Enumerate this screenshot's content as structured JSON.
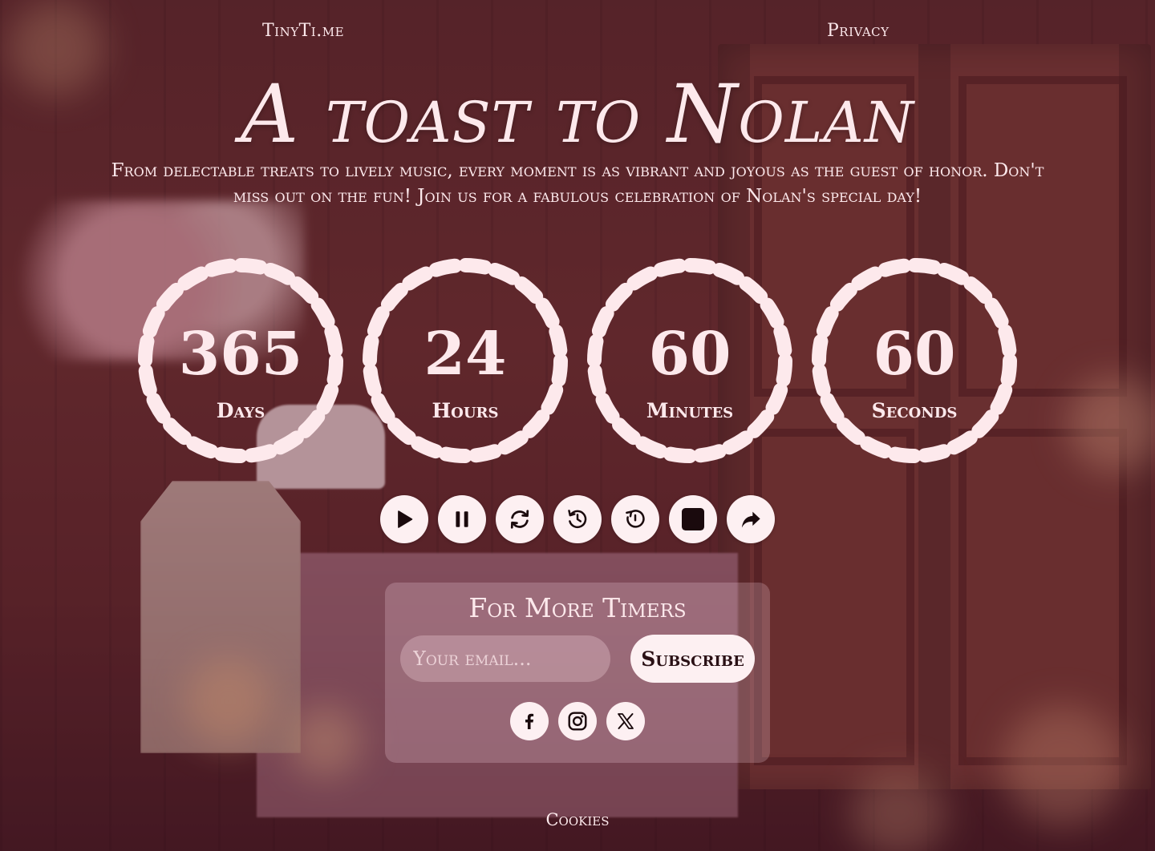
{
  "nav": {
    "brand": "TinyTi.me",
    "privacy": "Privacy"
  },
  "hero": {
    "title": "A toast to Nolan",
    "tagline": "From delectable treats to lively music, every moment is as vibrant and joyous as the guest of honor. Don't miss out on the fun! Join us for a fabulous celebration of Nolan's special day!"
  },
  "countdown": [
    {
      "value": "365",
      "unit": "Days"
    },
    {
      "value": "24",
      "unit": "Hours"
    },
    {
      "value": "60",
      "unit": "Minutes"
    },
    {
      "value": "60",
      "unit": "Seconds"
    }
  ],
  "controls": [
    "play-icon",
    "pause-icon",
    "refresh-icon",
    "history-icon",
    "reset-timer-icon",
    "stop-icon",
    "share-icon"
  ],
  "subscribe": {
    "heading": "For More Timers",
    "email_placeholder": "Your email...",
    "button_label": "Subscribe"
  },
  "social": [
    "facebook-icon",
    "instagram-icon",
    "x-icon"
  ],
  "footer": {
    "cookies": "Cookies"
  },
  "colors": {
    "text": "#fde9ec",
    "button_bg": "#fdf0f2",
    "icon": "#1a0a0d",
    "overlay": "#50142d"
  }
}
